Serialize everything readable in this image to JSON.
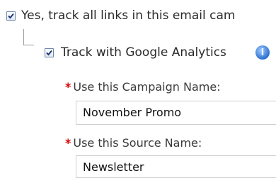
{
  "tracking": {
    "track_all_links_label": "Yes, track all links in this email cam",
    "track_all_links_checked": true,
    "google_analytics_label": "Track with Google Analytics",
    "google_analytics_checked": true,
    "info_icon": "google-analytics-info-icon"
  },
  "campaign_field": {
    "required_mark": "*",
    "label": "Use this Campaign Name:",
    "value": "November Promo"
  },
  "source_field": {
    "required_mark": "*",
    "label": "Use this Source Name:",
    "value": "Newsletter"
  },
  "colors": {
    "required": "#d40000",
    "checkbox_border": "#6d86a8",
    "checkmark": "#1d3c72"
  }
}
